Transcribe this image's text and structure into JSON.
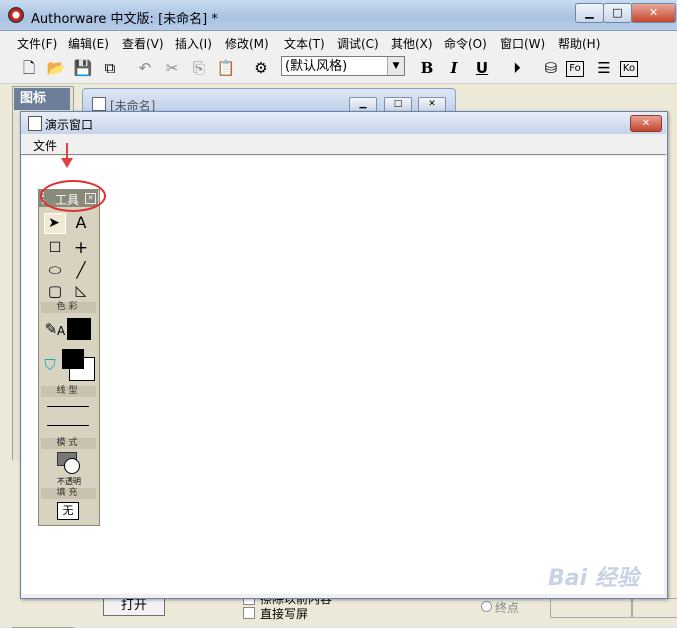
{
  "app": {
    "title": "Authorware 中文版: [未命名] *",
    "caption_buttons": {
      "minimize": "▁",
      "maximize": "□",
      "close": "✕"
    }
  },
  "menu": [
    "文件(F)",
    "编辑(E)",
    "查看(V)",
    "插入(I)",
    "修改(M)",
    "文本(T)",
    "调试(C)",
    "其他(X)",
    "命令(O)",
    "窗口(W)",
    "帮助(H)"
  ],
  "toolbar": {
    "style_select": "(默认风格)",
    "bold": "B",
    "italic": "I",
    "underline": "U",
    "fo": "Fo",
    "ko": "Ko"
  },
  "icons_panel": {
    "tab": "图标"
  },
  "flowline": {
    "title": "[未命名]"
  },
  "presentation": {
    "title": "演示窗口",
    "menu_file": "文件"
  },
  "tools": {
    "title": "工具",
    "text_tool": "A",
    "cross_tool": "+",
    "section_color": "色彩",
    "text_color_label": "A",
    "section_line": "线型",
    "section_mode": "模式",
    "mode_label": "不透明",
    "section_fill": "填充",
    "fill_value": "无"
  },
  "bottom": {
    "open_button": "打开",
    "erase_label": "擦除以前内容",
    "direct_label": "直接写屏",
    "end_label": "终点"
  },
  "watermark": "Bai 经验",
  "colors": {
    "highlight": "#e03030",
    "titlebar": "#a9c3e3"
  }
}
